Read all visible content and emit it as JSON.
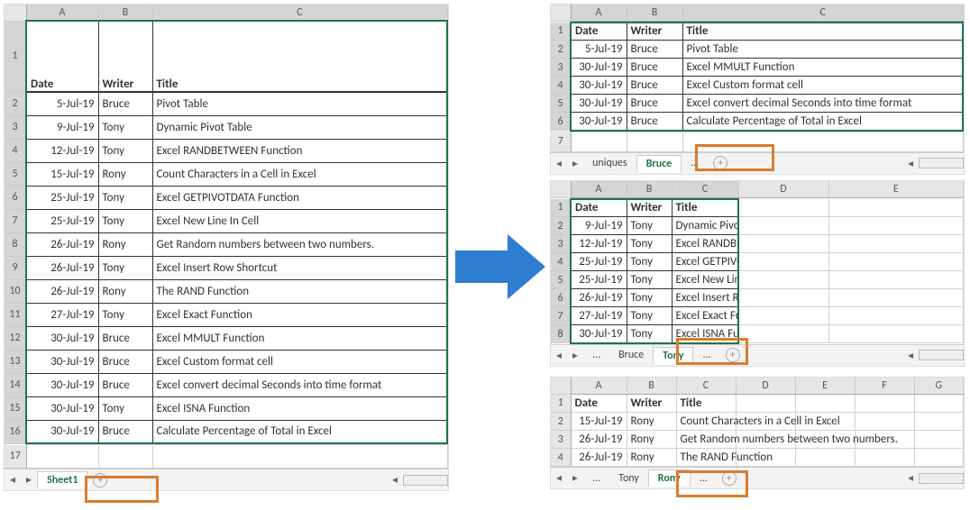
{
  "source": {
    "headers": [
      "Date",
      "Writer",
      "Title"
    ],
    "rows": [
      {
        "d": "5-Jul-19",
        "w": "Bruce",
        "t": "Pivot Table"
      },
      {
        "d": "9-Jul-19",
        "w": "Tony",
        "t": "Dynamic Pivot Table"
      },
      {
        "d": "12-Jul-19",
        "w": "Tony",
        "t": "Excel RANDBETWEEN Function"
      },
      {
        "d": "15-Jul-19",
        "w": "Rony",
        "t": "Count Characters in a Cell in Excel"
      },
      {
        "d": "25-Jul-19",
        "w": "Tony",
        "t": "Excel GETPIVOTDATA Function"
      },
      {
        "d": "25-Jul-19",
        "w": "Tony",
        "t": "Excel New Line In Cell"
      },
      {
        "d": "26-Jul-19",
        "w": "Rony",
        "t": "Get Random numbers between two numbers."
      },
      {
        "d": "26-Jul-19",
        "w": "Tony",
        "t": "Excel Insert Row Shortcut"
      },
      {
        "d": "26-Jul-19",
        "w": "Rony",
        "t": "The RAND Function"
      },
      {
        "d": "27-Jul-19",
        "w": "Tony",
        "t": "Excel Exact Function"
      },
      {
        "d": "30-Jul-19",
        "w": "Bruce",
        "t": "Excel MMULT Function"
      },
      {
        "d": "30-Jul-19",
        "w": "Bruce",
        "t": "Excel Custom format cell"
      },
      {
        "d": "30-Jul-19",
        "w": "Bruce",
        "t": "Excel convert decimal Seconds into time format"
      },
      {
        "d": "30-Jul-19",
        "w": "Tony",
        "t": "Excel ISNA Function"
      },
      {
        "d": "30-Jul-19",
        "w": "Bruce",
        "t": "Calculate Percentage of Total in Excel"
      }
    ],
    "tab": "Sheet1",
    "cols": [
      "A",
      "B",
      "C"
    ]
  },
  "bruce": {
    "headers": [
      "Date",
      "Writer",
      "Title"
    ],
    "rows": [
      {
        "d": "5-Jul-19",
        "w": "Bruce",
        "t": "Pivot Table"
      },
      {
        "d": "30-Jul-19",
        "w": "Bruce",
        "t": "Excel MMULT Function"
      },
      {
        "d": "30-Jul-19",
        "w": "Bruce",
        "t": "Excel Custom format cell"
      },
      {
        "d": "30-Jul-19",
        "w": "Bruce",
        "t": "Excel convert decimal Seconds into time format"
      },
      {
        "d": "30-Jul-19",
        "w": "Bruce",
        "t": "Calculate Percentage of Total in Excel"
      }
    ],
    "tab": "Bruce",
    "othertab": "uniques",
    "cols": [
      "A",
      "B",
      "C"
    ]
  },
  "tony": {
    "headers": [
      "Date",
      "Writer",
      "Title"
    ],
    "rows": [
      {
        "d": "9-Jul-19",
        "w": "Tony",
        "t": "Dynamic Pivot Table"
      },
      {
        "d": "12-Jul-19",
        "w": "Tony",
        "t": "Excel RANDBETWEEN Function"
      },
      {
        "d": "25-Jul-19",
        "w": "Tony",
        "t": "Excel GETPIVOTDATA Function"
      },
      {
        "d": "25-Jul-19",
        "w": "Tony",
        "t": "Excel New Line In Cell"
      },
      {
        "d": "26-Jul-19",
        "w": "Tony",
        "t": "Excel Insert Row Shortcut"
      },
      {
        "d": "27-Jul-19",
        "w": "Tony",
        "t": "Excel Exact Function"
      },
      {
        "d": "30-Jul-19",
        "w": "Tony",
        "t": "Excel ISNA Function"
      }
    ],
    "tab": "Tony",
    "othertab": "Bruce",
    "cols": [
      "A",
      "B",
      "C",
      "D",
      "E"
    ]
  },
  "rony": {
    "headers": [
      "Date",
      "Writer",
      "Title"
    ],
    "rows": [
      {
        "d": "15-Jul-19",
        "w": "Rony",
        "t": "Count Characters in a Cell in Excel"
      },
      {
        "d": "26-Jul-19",
        "w": "Rony",
        "t": "Get Random numbers between two numbers."
      },
      {
        "d": "26-Jul-19",
        "w": "Rony",
        "t": "The RAND Function"
      }
    ],
    "tab": "Rony",
    "othertab": "Tony",
    "cols": [
      "A",
      "B",
      "C",
      "D",
      "E",
      "F",
      "G"
    ]
  },
  "nav": {
    "dots": "...",
    "plus": "+"
  }
}
